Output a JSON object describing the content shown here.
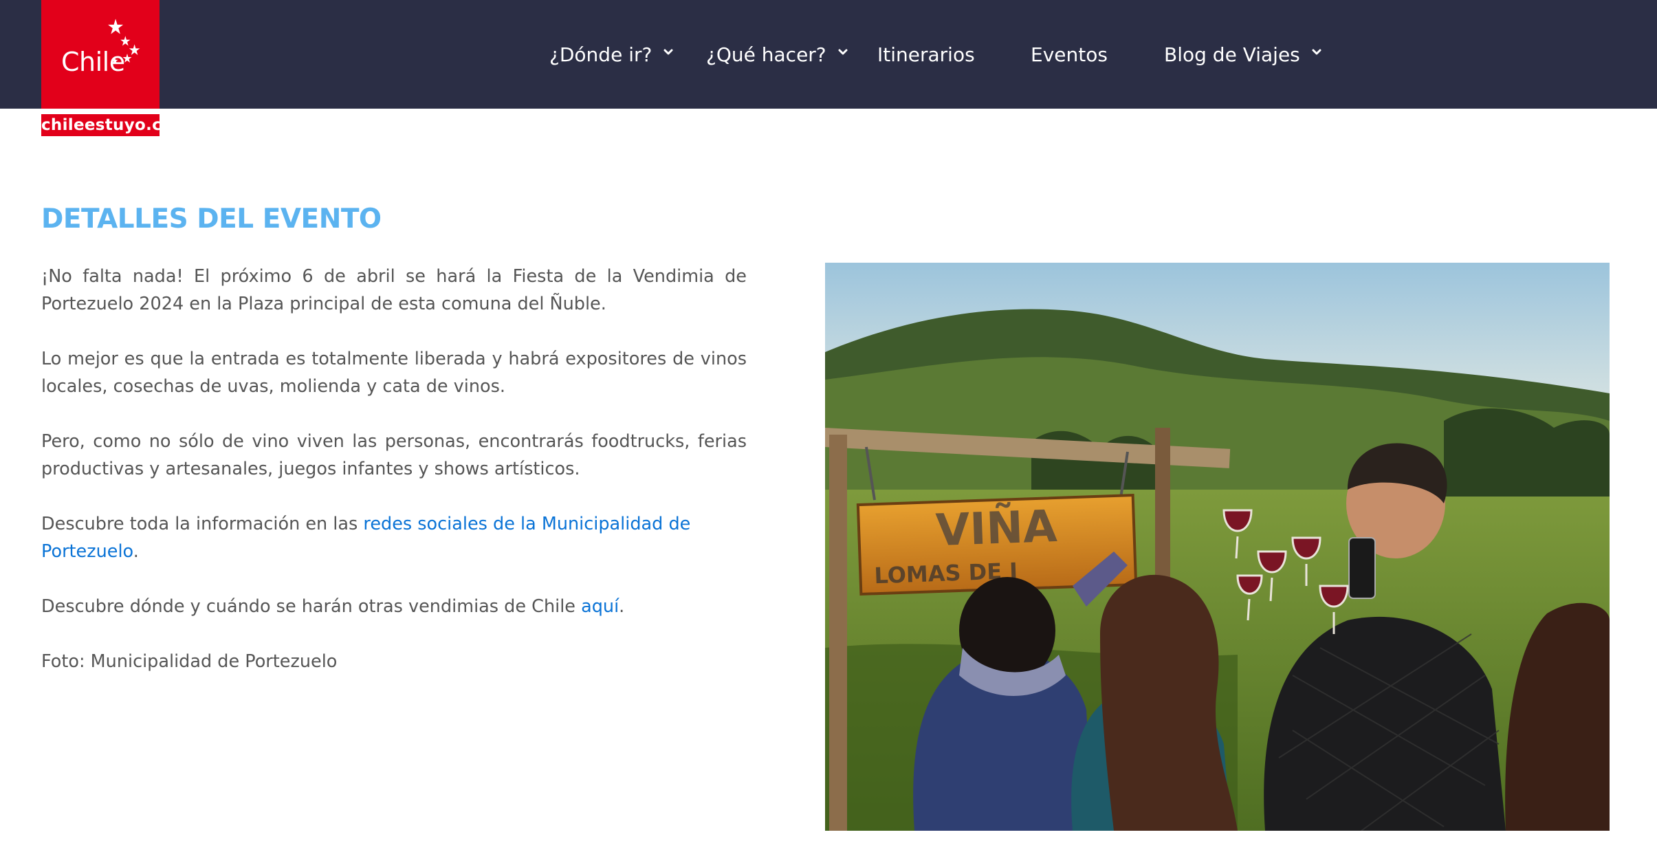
{
  "logo": {
    "wordmark": "Chile",
    "domain": "chileestuyo.cl"
  },
  "nav": {
    "items": [
      {
        "label": "¿Dónde ir?",
        "dropdown": true
      },
      {
        "label": "¿Qué hacer?",
        "dropdown": true
      },
      {
        "label": "Itinerarios",
        "dropdown": false
      },
      {
        "label": "Eventos",
        "dropdown": false
      },
      {
        "label": "Blog de Viajes",
        "dropdown": true
      }
    ]
  },
  "content": {
    "title": "DETALLES DEL EVENTO",
    "p1": "¡No falta nada! El próximo 6 de abril se hará la Fiesta de la Vendimia de Portezuelo 2024 en la Plaza principal de esta comuna del Ñuble.",
    "p2": "Lo mejor es que la entrada es totalmente liberada y habrá expositores de vinos locales, cosechas de uvas, molienda y cata de vinos.",
    "p3": "Pero, como no sólo de vino viven las personas, encontrarás foodtrucks, ferias productivas y artesanales, juegos infantes y shows artísticos.",
    "p4_prefix": "Descubre toda la información en las ",
    "p4_link": "redes sociales de la Municipalidad de Portezuelo",
    "p4_suffix": ".",
    "p5_prefix": "Descubre dónde y cuándo se harán otras vendimias de Chile ",
    "p5_link": "aquí",
    "p5_suffix": ".",
    "photo_credit": "Foto: Municipalidad de Portezuelo"
  },
  "photo": {
    "sign_line1": "VIÑA",
    "sign_line2": "LOMAS DE J"
  },
  "colors": {
    "header_bg": "#2b2e45",
    "brand_red": "#e2001a",
    "title_blue": "#5bb3f0",
    "link_blue": "#0a73d6",
    "body_text": "#555555"
  },
  "icons": {
    "logo_stars": "star-cluster-icon",
    "dropdown": "chevron-down-icon"
  }
}
